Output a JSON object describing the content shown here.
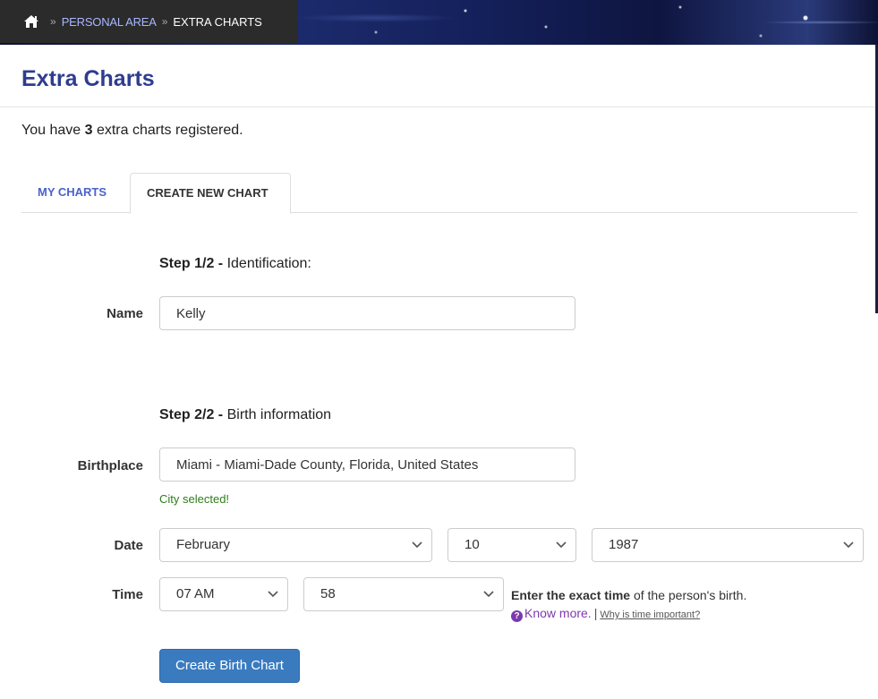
{
  "breadcrumb": {
    "home_icon": "home-icon",
    "separator": "»",
    "items": [
      {
        "label": "PERSONAL AREA"
      },
      {
        "label": "EXTRA CHARTS"
      }
    ]
  },
  "page": {
    "title": "Extra Charts",
    "summary_prefix": "You have ",
    "summary_count": "3",
    "summary_suffix": " extra charts registered."
  },
  "tabs": [
    {
      "label": "MY CHARTS",
      "active": false
    },
    {
      "label": "CREATE NEW CHART",
      "active": true
    }
  ],
  "form": {
    "step1": {
      "bold": "Step 1/2 -",
      "text": " Identification:"
    },
    "name": {
      "label": "Name",
      "value": "Kelly"
    },
    "step2": {
      "bold": "Step 2/2 -",
      "text": " Birth information"
    },
    "birthplace": {
      "label": "Birthplace",
      "value": "Miami - Miami-Dade County, Florida, United States",
      "status": "City selected!"
    },
    "date": {
      "label": "Date",
      "month": "February",
      "day": "10",
      "year": "1987"
    },
    "time": {
      "label": "Time",
      "hour": "07 AM",
      "minute": "58"
    },
    "hint": {
      "bold": "Enter the exact time",
      "text": " of the person's birth.",
      "know_more": "Know more.",
      "pipe": "|",
      "why": "Why is time important?"
    },
    "submit_label": "Create Birth Chart"
  },
  "colors": {
    "title": "#2e3d8f",
    "tab_link": "#4a62c9",
    "success": "#2e7d1a",
    "button": "#3a7bbf",
    "link_purple": "#7c3aad"
  }
}
